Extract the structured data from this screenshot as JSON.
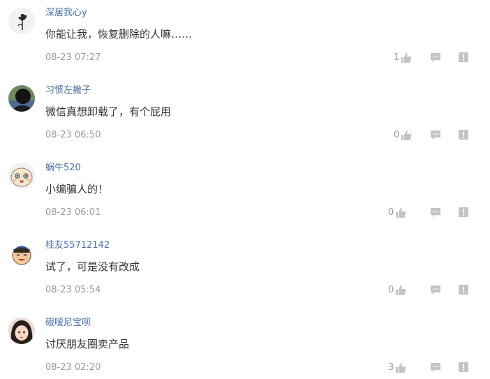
{
  "colors": {
    "username": "#4a6ea8",
    "text": "#333333",
    "meta": "#999999",
    "icon": "#c4c4c4"
  },
  "comments": [
    {
      "username": "深居我心y",
      "content": "你能让我，恢复删除的人嘛……",
      "time": "08-23 07:27",
      "likes": "1",
      "avatar_icon": "rose-avatar-icon"
    },
    {
      "username": "习惯左撇子",
      "content": "微信真想卸载了，有个屁用",
      "time": "08-23 06:50",
      "likes": "0",
      "avatar_icon": "silhouette-avatar-icon"
    },
    {
      "username": "蜗牛520",
      "content": "小编骗人的！",
      "time": "08-23 06:01",
      "likes": "0",
      "avatar_icon": "cartoon-avatar-icon"
    },
    {
      "username": "桂友55712142",
      "content": "试了，可是没有改成",
      "time": "08-23 05:54",
      "likes": "0",
      "avatar_icon": "cartoon-graduate-avatar-icon"
    },
    {
      "username": "硪嗳尼宝呗",
      "content": "讨厌朋友圈卖产品",
      "time": "08-23 02:20",
      "likes": "3",
      "avatar_icon": "girl-photo-avatar-icon"
    }
  ]
}
